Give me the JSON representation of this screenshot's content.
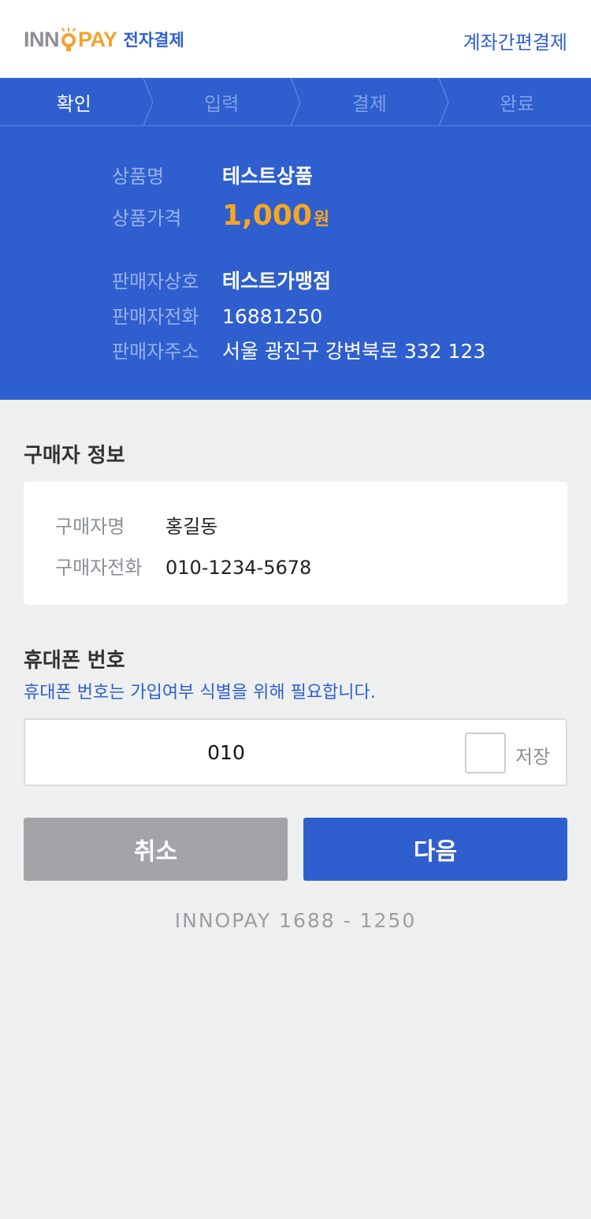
{
  "header": {
    "logo_text_left": "INN",
    "logo_text_right": "PAY",
    "logo_subtitle": "전자결제",
    "link": "계좌간편결제"
  },
  "steps": [
    {
      "label": "확인",
      "active": true
    },
    {
      "label": "입력",
      "active": false
    },
    {
      "label": "결제",
      "active": false
    },
    {
      "label": "완료",
      "active": false
    }
  ],
  "product": {
    "name_label": "상품명",
    "name": "테스트상품",
    "price_label": "상품가격",
    "price": "1,000",
    "price_unit": "원"
  },
  "seller": {
    "name_label": "판매자상호",
    "name": "테스트가맹점",
    "phone_label": "판매자전화",
    "phone": "16881250",
    "address_label": "판매자주소",
    "address": "서울 광진구 강변북로 332 123"
  },
  "buyer": {
    "section_title": "구매자 정보",
    "name_label": "구매자명",
    "name": "홍길동",
    "phone_label": "구매자전화",
    "phone": "010-1234-5678"
  },
  "phone_section": {
    "title": "휴대폰 번호",
    "hint": "휴대폰 번호는 가입여부 식별을 위해 필요합니다.",
    "value": "010",
    "save_label": "저장",
    "save_checked": false
  },
  "buttons": {
    "cancel": "취소",
    "next": "다음"
  },
  "footer": {
    "text": "INNOPAY 1688 - 1250"
  },
  "colors": {
    "brand_blue": "#2f5fce",
    "accent_orange": "#f5a623",
    "button_gray": "#a2a4a7"
  }
}
